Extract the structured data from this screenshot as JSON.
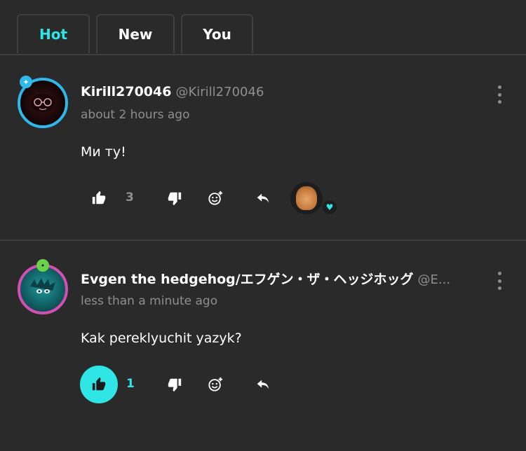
{
  "tabs": [
    {
      "label": "Hot",
      "active": true
    },
    {
      "label": "New",
      "active": false
    },
    {
      "label": "You",
      "active": false
    }
  ],
  "colors": {
    "accent": "#2fe5e6",
    "background": "#2b2a2b",
    "muted_text": "#8f8e90",
    "divider": "#3f3e40"
  },
  "comments": [
    {
      "display_name": "Kirill270046",
      "handle": "@Kirill270046",
      "time": "about 2 hours ago",
      "text": "Ми ту!",
      "likes": "3",
      "liked": false,
      "icons": [
        "like-icon",
        "dislike-icon",
        "add-reaction-icon",
        "reply-icon"
      ],
      "reactions": [
        {
          "icon": "heart-icon",
          "color": "#2fe5e6"
        }
      ]
    },
    {
      "display_name": "Evgen the hedgehog/エフゲン・ザ・ヘッジホッグ",
      "handle": "@E...",
      "time": "less than a minute ago",
      "text": "Kak pereklyuchit yazyk?",
      "likes": "1",
      "liked": true,
      "icons": [
        "like-icon",
        "dislike-icon",
        "add-reaction-icon",
        "reply-icon"
      ]
    }
  ]
}
